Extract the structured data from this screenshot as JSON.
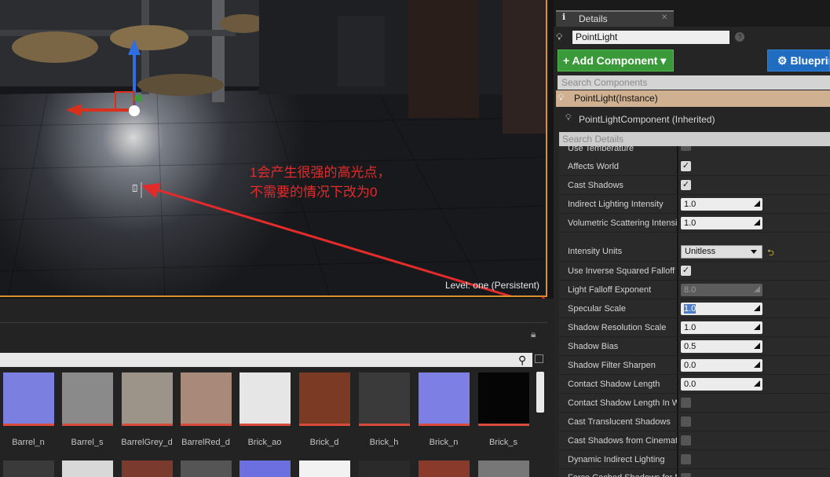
{
  "viewport": {
    "level_label": "Level:  one (Persistent)",
    "annotation": "1会产生很强的高光点，\n不需要的情况下改为0",
    "annotation_color": "#e32b2b"
  },
  "content_browser": {
    "assets": [
      {
        "label": "Barrel_n",
        "color": "#7b7fe0",
        "bar": "#d84a3a"
      },
      {
        "label": "Barrel_s",
        "color": "#8a8a8a",
        "bar": "#d84a3a"
      },
      {
        "label": "BarrelGrey_d",
        "color": "#9c9488",
        "bar": "#d84a3a"
      },
      {
        "label": "BarrelRed_d",
        "color": "#a98a7a",
        "bar": "#d84a3a"
      },
      {
        "label": "Brick_ao",
        "color": "#e6e6e6",
        "bar": "#d84a3a"
      },
      {
        "label": "Brick_d",
        "color": "#7a3a24",
        "bar": "#d84a3a"
      },
      {
        "label": "Brick_h",
        "color": "#3a3a3a",
        "bar": "#d84a3a"
      },
      {
        "label": "Brick_n",
        "color": "#7d7fe4",
        "bar": "#d84a3a"
      },
      {
        "label": "Brick_s",
        "color": "#050505",
        "bar": "#d84a3a"
      }
    ]
  },
  "details": {
    "tab_label": "Details",
    "name_value": "PointLight",
    "add_component": "+ Add Component ▾",
    "blueprint": "⚙ Blueprint/Add Script",
    "search_components_placeholder": "Search Components",
    "component_instance": "PointLight(Instance)",
    "component_child": "PointLightComponent (Inherited)",
    "search_details_placeholder": "Search Details",
    "properties": {
      "use_temperature": {
        "label": "Use Temperature"
      },
      "affects_world": {
        "label": "Affects World",
        "checked": "✓"
      },
      "cast_shadows": {
        "label": "Cast Shadows",
        "checked": "✓"
      },
      "indirect_lighting": {
        "label": "Indirect Lighting Intensity",
        "value": "1.0"
      },
      "volumetric": {
        "label": "Volumetric Scattering Intensity",
        "value": "1.0"
      },
      "intensity_units": {
        "label": "Intensity Units",
        "value": "Unitless"
      },
      "inverse_squared": {
        "label": "Use Inverse Squared Falloff",
        "checked": "✓"
      },
      "falloff_exponent": {
        "label": "Light Falloff Exponent",
        "value": "8.0"
      },
      "specular_scale": {
        "label": "Specular Scale",
        "value": "1.0"
      },
      "shadow_resolution": {
        "label": "Shadow Resolution Scale",
        "value": "1.0"
      },
      "shadow_bias": {
        "label": "Shadow Bias",
        "value": "0.5"
      },
      "shadow_filter": {
        "label": "Shadow Filter Sharpen",
        "value": "0.0"
      },
      "contact_shadow": {
        "label": "Contact Shadow Length",
        "value": "0.0"
      },
      "contact_shadow_ws": {
        "label": "Contact Shadow Length In World Space"
      },
      "cast_translucent": {
        "label": "Cast Translucent Shadows"
      },
      "cast_cinematic": {
        "label": "Cast Shadows from Cinematic Objects Only"
      },
      "dynamic_indirect": {
        "label": "Dynamic Indirect Lighting"
      },
      "force_cached": {
        "label": "Force Cached Shadows for Movable Primitives"
      }
    }
  }
}
